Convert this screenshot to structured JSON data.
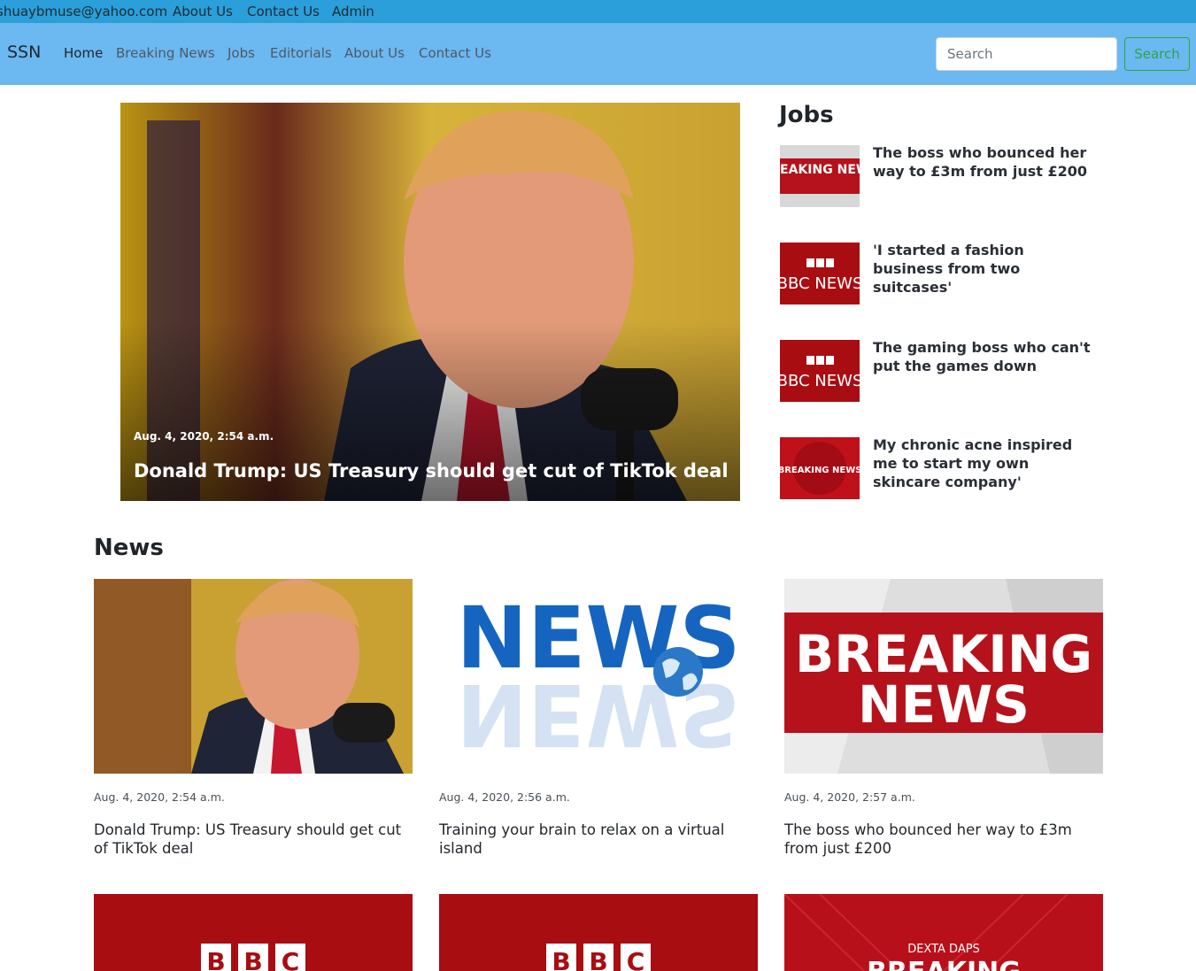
{
  "topbar": {
    "email": "shuaybmuse@yahoo.com",
    "about": "About Us",
    "contact": "Contact Us",
    "admin": "Admin"
  },
  "navbar": {
    "brand": "SSN",
    "links": [
      "Home",
      "Breaking News",
      "Jobs",
      "Editorials",
      "About Us",
      "Contact Us"
    ],
    "search_placeholder": "Search",
    "search_button": "Search"
  },
  "hero": {
    "date": "Aug. 4, 2020, 2:54 a.m.",
    "title": "Donald Trump: US Treasury should get cut of TikTok deal"
  },
  "jobs": {
    "heading": "Jobs",
    "items": [
      {
        "title": "The boss who bounced her way to £3m from just £200",
        "thumb": "BREAKING NEWS"
      },
      {
        "title": "'I started a fashion business from two suitcases'",
        "thumb": "BBC NEWS"
      },
      {
        "title": "The gaming boss who can't put the games down",
        "thumb": "BBC NEWS"
      },
      {
        "title": "My chronic acne inspired me to start my own skincare company'",
        "thumb": "BREAKING NEWS"
      }
    ]
  },
  "news": {
    "heading": "News",
    "cards": [
      {
        "date": "Aug. 4, 2020, 2:54 a.m.",
        "title": "Donald Trump: US Treasury should get cut of TikTok deal",
        "image": "portrait"
      },
      {
        "date": "Aug. 4, 2020, 2:56 a.m.",
        "title": "Training your brain to relax on a virtual island",
        "image_text": "NEWS"
      },
      {
        "date": "Aug. 4, 2020, 2:57 a.m.",
        "title": "The boss who bounced her way to £3m from just £200",
        "image_text_1": "BREAKING",
        "image_text_2": "NEWS"
      }
    ],
    "partial_cards": [
      {
        "image_text": "BBC"
      },
      {
        "image_text": "BBC"
      },
      {
        "image_text": "DEXTA DAPS",
        "image_text_2": "BREAKING"
      }
    ]
  },
  "colors": {
    "topbar": "#2b9fd9",
    "navbar": "#6cb8f0",
    "search_button": "#28a745",
    "bbc_red": "#a80d12"
  }
}
